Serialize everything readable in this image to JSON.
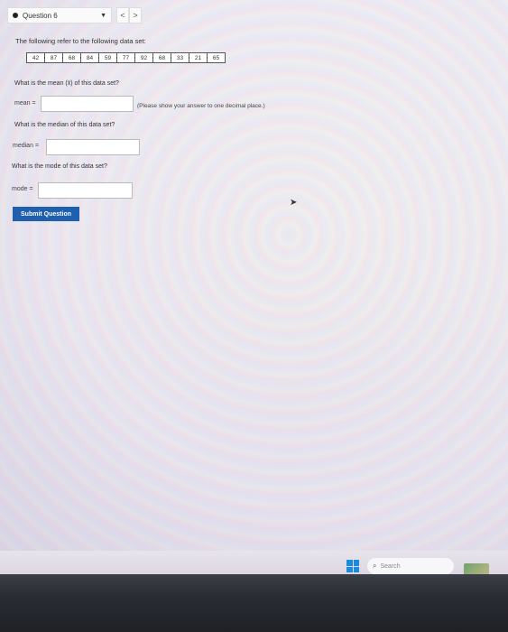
{
  "header": {
    "question_label": "Question 6",
    "prev_label": "<",
    "next_label": ">"
  },
  "intro": "The following refer to the following data set:",
  "data_set": [
    "42",
    "87",
    "68",
    "84",
    "59",
    "77",
    "92",
    "68",
    "33",
    "21",
    "65"
  ],
  "mean": {
    "question": "What is the mean (x̄) of this data set?",
    "label": "mean =",
    "value": "",
    "note": "(Please show your answer to one decimal place.)"
  },
  "median": {
    "question": "What is the median of this data set?",
    "label": "median =",
    "value": ""
  },
  "mode": {
    "question": "What is the mode of this data set?",
    "label": "mode =",
    "value": ""
  },
  "submit_label": "Submit Question",
  "taskbar": {
    "search_placeholder": "Search",
    "icons": [
      "windows-icon",
      "search-icon"
    ]
  },
  "colors": {
    "submit_bg": "#1f5fb0",
    "windows_blue": "#1a8ce0"
  }
}
